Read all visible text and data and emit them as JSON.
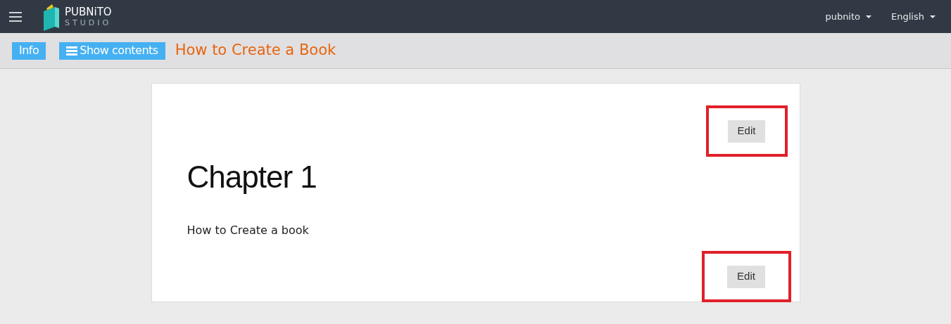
{
  "navbar": {
    "logo": {
      "name": "PUBNiTO",
      "sub": "STUDIO"
    },
    "menus": [
      {
        "label": "pubnito"
      },
      {
        "label": "English"
      }
    ]
  },
  "toolbar": {
    "buttons": [
      {
        "label": "Info",
        "kind": "plain"
      },
      {
        "label": "Show contents",
        "kind": "menu"
      }
    ],
    "title": "How to Create a Book"
  },
  "card": {
    "top_edit": {
      "label": "Edit",
      "highlighted": true
    },
    "heading": "Chapter 1",
    "text": "How to Create a book",
    "bottom_edit": {
      "label": "Edit",
      "highlighted": true
    }
  }
}
